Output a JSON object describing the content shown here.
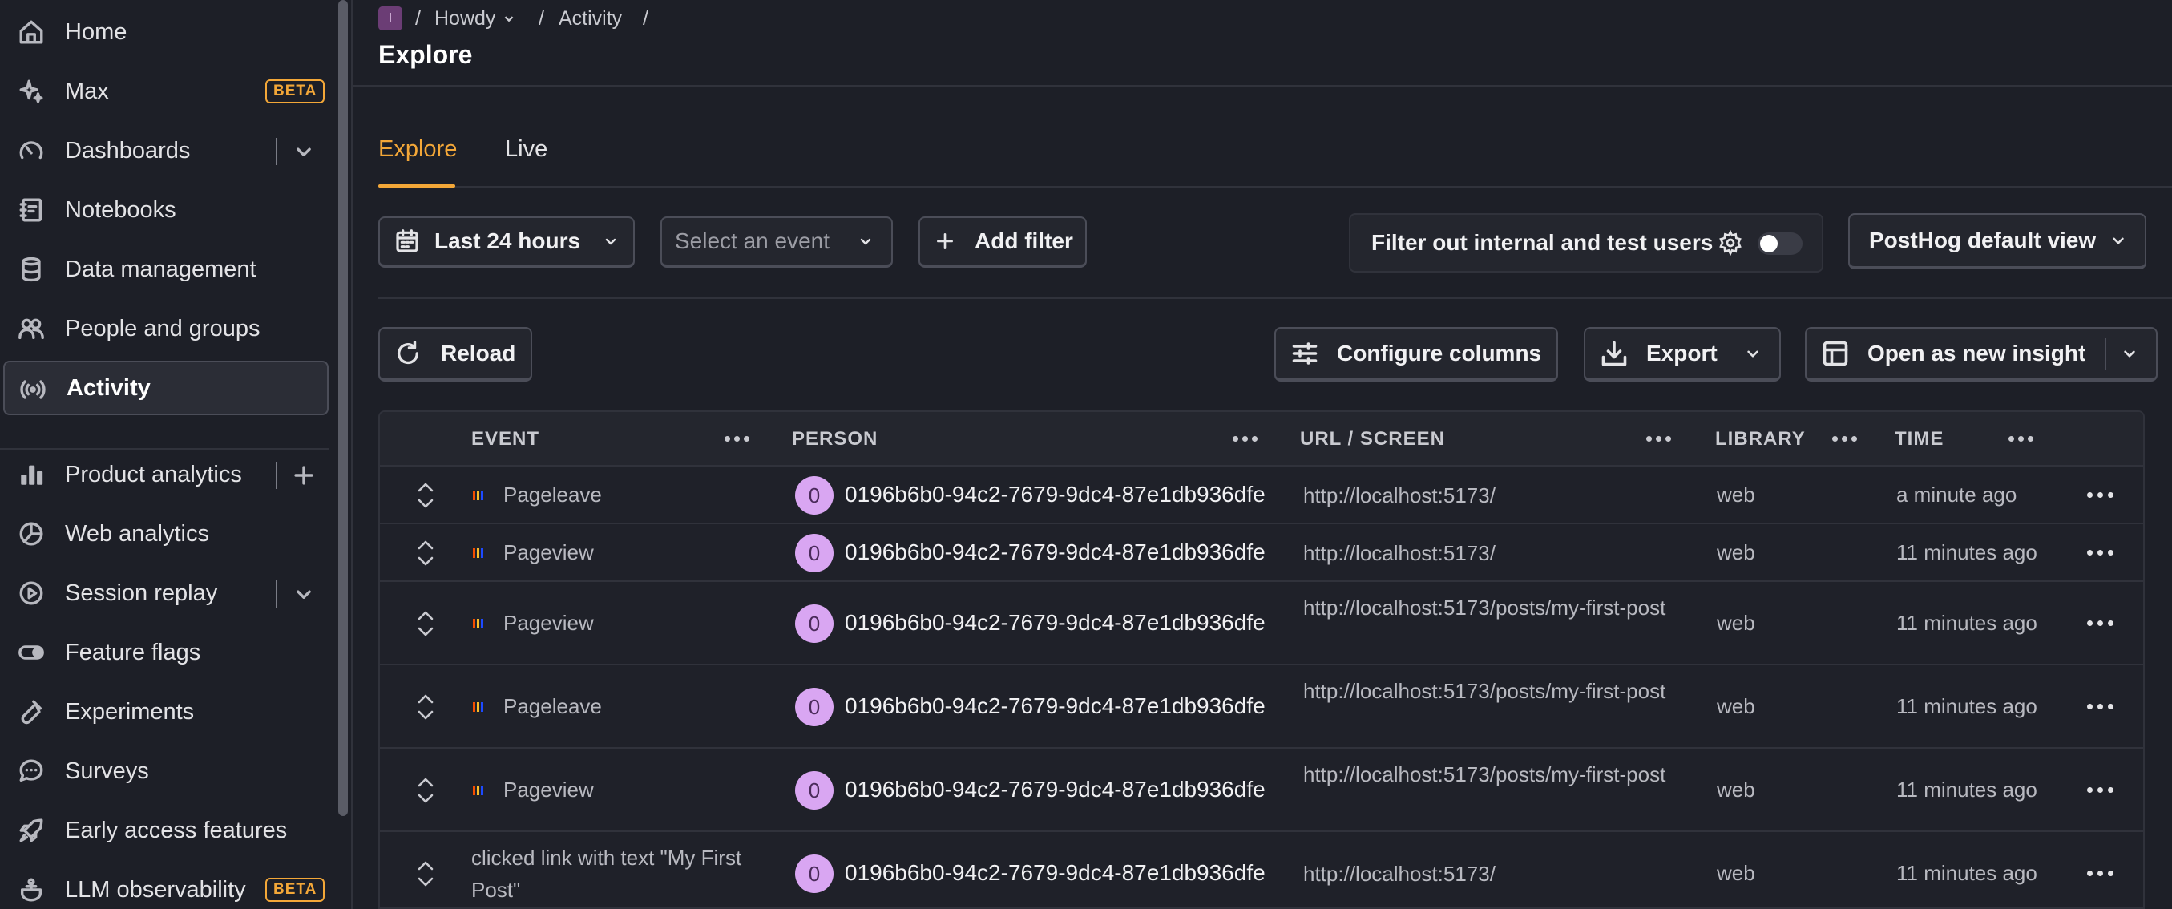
{
  "sidebar": {
    "items": [
      {
        "label": "Home",
        "icon": "home-icon"
      },
      {
        "label": "Max",
        "icon": "sparkle-icon",
        "badge": "BETA"
      },
      {
        "label": "Dashboards",
        "icon": "gauge-icon"
      },
      {
        "label": "Notebooks",
        "icon": "notebook-icon"
      },
      {
        "label": "Data management",
        "icon": "database-icon"
      },
      {
        "label": "People and groups",
        "icon": "people-icon"
      },
      {
        "label": "Activity",
        "icon": "broadcast-icon"
      },
      {
        "label": "Product analytics",
        "icon": "bar-chart-icon"
      },
      {
        "label": "Web analytics",
        "icon": "pie-chart-icon"
      },
      {
        "label": "Session replay",
        "icon": "play-circle-icon"
      },
      {
        "label": "Feature flags",
        "icon": "toggle-icon"
      },
      {
        "label": "Experiments",
        "icon": "flask-icon"
      },
      {
        "label": "Surveys",
        "icon": "chat-bubble-icon"
      },
      {
        "label": "Early access features",
        "icon": "rocket-icon"
      },
      {
        "label": "LLM observability",
        "icon": "llm-icon",
        "badge": "BETA"
      }
    ]
  },
  "header": {
    "project_initial": "I",
    "project": "Howdy",
    "section": "Activity",
    "sep": "/",
    "title": "Explore"
  },
  "tabs": [
    {
      "label": "Explore",
      "active": true
    },
    {
      "label": "Live",
      "active": false
    }
  ],
  "toolbar": {
    "date_range": "Last 24 hours",
    "event_placeholder": "Select an event",
    "add_filter": "Add filter",
    "internal_filter": "Filter out internal and test users",
    "view": "PostHog default view",
    "reload": "Reload",
    "configure_columns": "Configure columns",
    "export": "Export",
    "open_insight": "Open as new insight"
  },
  "table": {
    "columns": [
      "EVENT",
      "PERSON",
      "URL / SCREEN",
      "LIBRARY",
      "TIME"
    ],
    "rows": [
      {
        "event": "Pageleave",
        "avatar": "0",
        "person": "0196b6b0-94c2-7679-9dc4-87e1db936dfe",
        "url": "http://localhost:5173/",
        "library": "web",
        "time": "a minute ago"
      },
      {
        "event": "Pageview",
        "avatar": "0",
        "person": "0196b6b0-94c2-7679-9dc4-87e1db936dfe",
        "url": "http://localhost:5173/",
        "library": "web",
        "time": "11 minutes ago"
      },
      {
        "event": "Pageview",
        "avatar": "0",
        "person": "0196b6b0-94c2-7679-9dc4-87e1db936dfe",
        "url": "http://localhost:5173/posts/my-first-post",
        "library": "web",
        "time": "11 minutes ago"
      },
      {
        "event": "Pageleave",
        "avatar": "0",
        "person": "0196b6b0-94c2-7679-9dc4-87e1db936dfe",
        "url": "http://localhost:5173/posts/my-first-post",
        "library": "web",
        "time": "11 minutes ago"
      },
      {
        "event": "Pageview",
        "avatar": "0",
        "person": "0196b6b0-94c2-7679-9dc4-87e1db936dfe",
        "url": "http://localhost:5173/posts/my-first-post",
        "library": "web",
        "time": "11 minutes ago"
      },
      {
        "event": "clicked link with text \"My First Post\"",
        "avatar": "0",
        "person": "0196b6b0-94c2-7679-9dc4-87e1db936dfe",
        "url": "http://localhost:5173/",
        "library": "web",
        "time": "11 minutes ago"
      }
    ]
  }
}
